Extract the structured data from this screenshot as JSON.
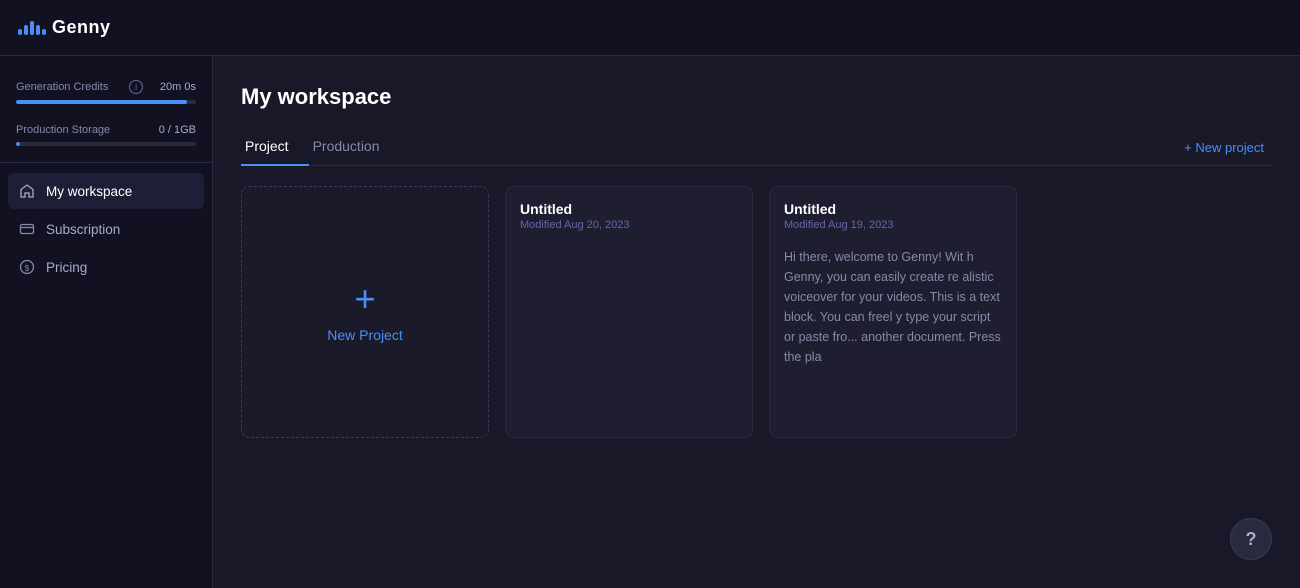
{
  "app": {
    "name": "Genny",
    "logo_bars": [
      6,
      10,
      14,
      10,
      6
    ]
  },
  "sidebar": {
    "credits": {
      "label": "Generation Credits",
      "value": "20m 0s",
      "progress_pct": 95
    },
    "storage": {
      "label": "Production Storage",
      "value": "0 / 1GB",
      "progress_pct": 2
    },
    "nav_items": [
      {
        "id": "workspace",
        "label": "My workspace",
        "icon": "home",
        "active": true
      },
      {
        "id": "subscription",
        "label": "Subscription",
        "icon": "card",
        "active": false
      },
      {
        "id": "pricing",
        "label": "Pricing",
        "icon": "circle",
        "active": false
      }
    ]
  },
  "main": {
    "page_title": "My workspace",
    "tabs": [
      {
        "id": "project",
        "label": "Project",
        "active": true
      },
      {
        "id": "production",
        "label": "Production",
        "active": false
      }
    ],
    "new_project_btn": "+ New project",
    "new_card_label": "New Project",
    "cards": [
      {
        "id": "card1",
        "title": "Untitled",
        "date": "Modified Aug 20, 2023",
        "preview": ""
      },
      {
        "id": "card2",
        "title": "Untitled",
        "date": "Modified Aug 19, 2023",
        "preview": "Hi there, welcome to Genny! Wit h Genny, you can easily create re alistic voiceover for your videos. This is a text block. You can freel y type your script or paste fro... another document. Press the pla"
      }
    ]
  },
  "help": {
    "icon": "?"
  }
}
